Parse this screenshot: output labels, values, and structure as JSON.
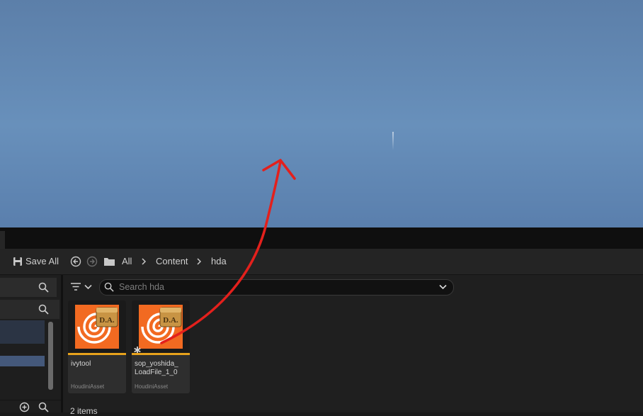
{
  "toolbar": {
    "save_all_label": "Save All",
    "breadcrumbs": [
      "All",
      "Content",
      "hda"
    ]
  },
  "search": {
    "placeholder": "Search hda",
    "value": ""
  },
  "assets": [
    {
      "name": "ivytool",
      "type": "HoudiniAsset",
      "modified": false
    },
    {
      "name": "sop_yoshida_LoadFile_1_0",
      "display_lines": [
        "sop_yoshida_",
        "LoadFile_1_0"
      ],
      "type": "HoudiniAsset",
      "modified": true
    }
  ],
  "status": {
    "item_count": "2 items"
  },
  "colors": {
    "viewport_sky": "#6890bb",
    "houdini_orange": "#f26a21",
    "asset_underline": "#e7a21c",
    "annotation_arrow": "#e3201c",
    "selection": "#44587a"
  },
  "icons": [
    "save-icon",
    "back-icon",
    "forward-icon",
    "folder-icon",
    "chevron-right-icon",
    "filter-icon",
    "search-icon",
    "chevron-down-icon",
    "add-icon",
    "houdini-logo-icon",
    "digital-asset-badge-icon",
    "modified-asterisk-icon"
  ]
}
